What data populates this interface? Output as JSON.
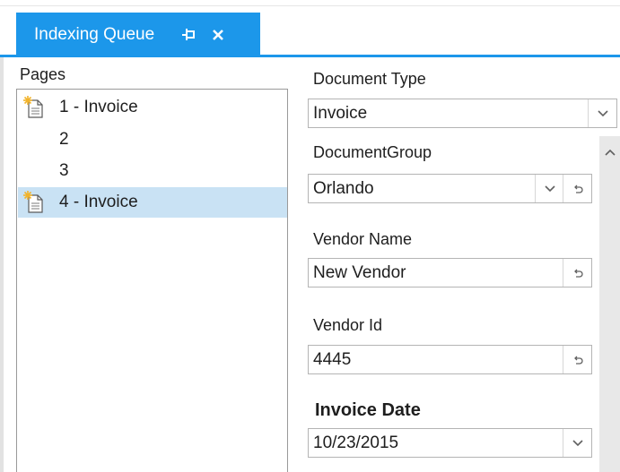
{
  "tab": {
    "title": "Indexing Queue"
  },
  "pages": {
    "label": "Pages",
    "items": [
      {
        "label": "1 - Invoice",
        "icon": "new-document-icon",
        "selected": false
      },
      {
        "label": "2",
        "icon": "",
        "selected": false
      },
      {
        "label": "3",
        "icon": "",
        "selected": false
      },
      {
        "label": "4 - Invoice",
        "icon": "new-document-icon",
        "selected": true
      }
    ]
  },
  "form": {
    "document_type": {
      "label": "Document Type",
      "value": "Invoice"
    },
    "document_group": {
      "label": "DocumentGroup",
      "value": "Orlando"
    },
    "vendor_name": {
      "label": "Vendor Name",
      "value": "New Vendor"
    },
    "vendor_id": {
      "label": "Vendor Id",
      "value": "4445"
    },
    "invoice_date": {
      "label": "Invoice Date",
      "value": "10/23/2015"
    }
  },
  "colors": {
    "accent": "#1c97ea",
    "selection": "#c9e2f4"
  }
}
